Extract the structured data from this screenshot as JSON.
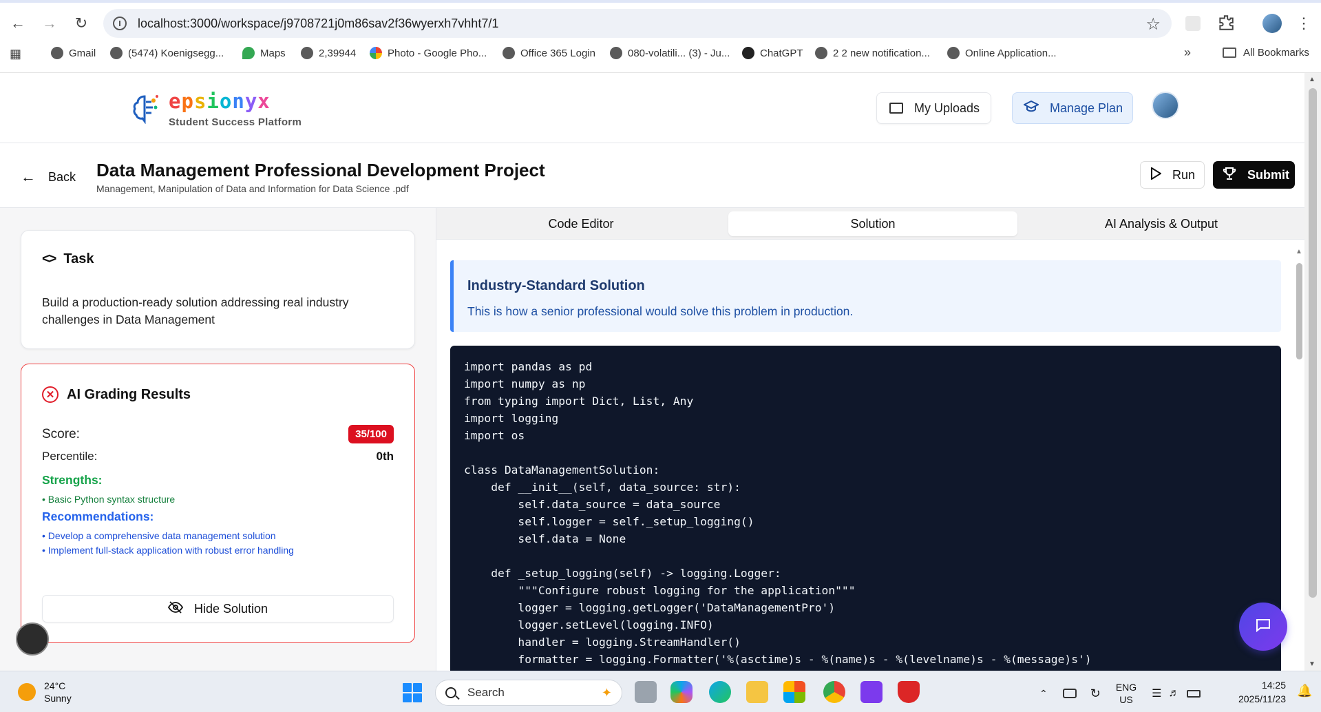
{
  "browser": {
    "url": "localhost:3000/workspace/j9708721j0m86sav2f36wyerxh7vhht7/1",
    "bookmarks": [
      {
        "label": "Gmail"
      },
      {
        "label": "(5474) Koenigsegg..."
      },
      {
        "label": "Maps"
      },
      {
        "label": "2,39944"
      },
      {
        "label": "Photo - Google Pho..."
      },
      {
        "label": "Office 365 Login"
      },
      {
        "label": "080-volatili... (3) - Ju..."
      },
      {
        "label": "ChatGPT"
      },
      {
        "label": "2 2 new notification..."
      },
      {
        "label": "Online Application..."
      }
    ],
    "all_bookmarks": "All Bookmarks",
    "more_icon": "»"
  },
  "header": {
    "logo": {
      "text": "epsionyx",
      "subtitle": "Student Success Platform"
    },
    "my_uploads": "My Uploads",
    "manage_plan": "Manage Plan"
  },
  "titlebar": {
    "back": "Back",
    "title": "Data Management Professional Development Project",
    "subtitle": "Management, Manipulation of Data and Information for Data Science .pdf",
    "run": "Run",
    "submit": "Submit"
  },
  "task": {
    "heading": "Task",
    "body": "Build a production-ready solution addressing real industry challenges in Data Management"
  },
  "grading": {
    "heading": "AI Grading Results",
    "score_label": "Score:",
    "score_value": "35/100",
    "percentile_label": "Percentile:",
    "percentile_value": "0th",
    "strengths_heading": "Strengths:",
    "strengths": [
      "• Basic Python syntax structure"
    ],
    "recommendations_heading": "Recommendations:",
    "recommendations": [
      "• Develop a comprehensive data management solution",
      "• Implement full-stack application with robust error handling"
    ],
    "hide_solution": "Hide Solution"
  },
  "tabs": [
    {
      "label": "Code Editor",
      "active": false
    },
    {
      "label": "Solution",
      "active": true
    },
    {
      "label": "AI Analysis & Output",
      "active": false
    }
  ],
  "solution": {
    "heading": "Industry-Standard Solution",
    "description": "This is how a senior professional would solve this problem in production.",
    "code": "import pandas as pd\nimport numpy as np\nfrom typing import Dict, List, Any\nimport logging\nimport os\n\nclass DataManagementSolution:\n    def __init__(self, data_source: str):\n        self.data_source = data_source\n        self.logger = self._setup_logging()\n        self.data = None\n\n    def _setup_logging(self) -> logging.Logger:\n        \"\"\"Configure robust logging for the application\"\"\"\n        logger = logging.getLogger('DataManagementPro')\n        logger.setLevel(logging.INFO)\n        handler = logging.StreamHandler()\n        formatter = logging.Formatter('%(asctime)s - %(name)s - %(levelname)s - %(message)s')"
  },
  "taskbar": {
    "weather_temp": "24°C",
    "weather_desc": "Sunny",
    "search": "Search",
    "lang_top": "ENG",
    "lang_bottom": "US",
    "time": "14:25",
    "date": "2025/11/23"
  },
  "colors": {
    "accent_blue": "#3b82f6",
    "danger_red": "#dc1020",
    "strength_green": "#16a34a",
    "recommend_blue": "#2563eb",
    "code_bg": "#0f172a"
  }
}
